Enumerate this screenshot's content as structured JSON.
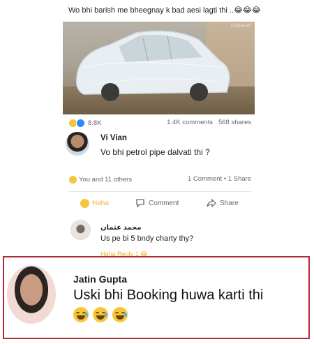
{
  "post": {
    "caption": "Wo bhi barish me bheegnay k bad aesi lagti thi ..😂😂😂",
    "image_watermark": "©3SRuel",
    "reaction_count": "8.8K",
    "comments_count": "1.4K comments",
    "shares_count": "568 shares"
  },
  "comment1": {
    "author": "Vi  Vian",
    "text": "Vo bhi petrol pipe dalvati thi ?",
    "reactions_summary": "You and 11 others",
    "stats": "1 Comment • 1 Share"
  },
  "actions": {
    "haha_label": "Haha",
    "comment_label": "Comment",
    "share_label": "Share"
  },
  "comment2": {
    "author": "محمد عثمان",
    "text": "Us pe bi 5 bndy charty thy?",
    "peek_text": "Haha    Reply                        1 😂"
  },
  "highlight": {
    "author": "Jatin Gupta",
    "text": "Uski bhi Booking huwa karti thi",
    "emojis": [
      "😅",
      "😅",
      "😅"
    ],
    "border_color": "#b52a3a"
  }
}
